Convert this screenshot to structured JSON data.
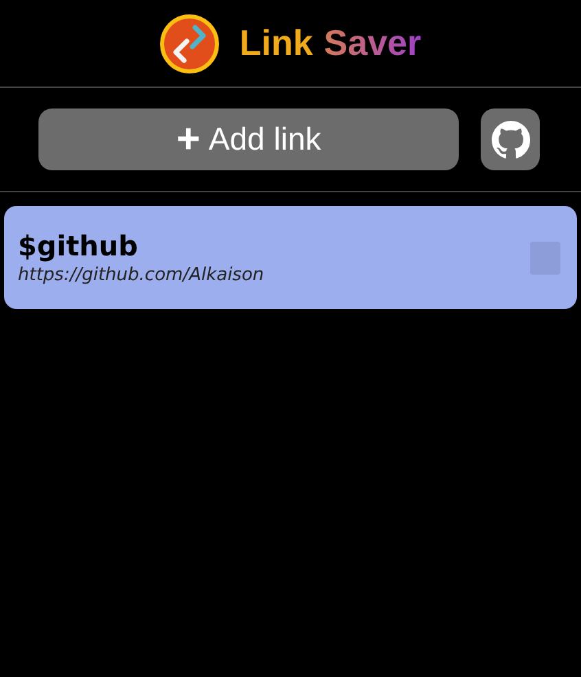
{
  "header": {
    "title_part_1": "Link",
    "title_part_2": "Saver"
  },
  "toolbar": {
    "add_button": {
      "icon": "+",
      "label": "Add link"
    }
  },
  "links": [
    {
      "name": "$github",
      "url": "https://github.com/Alkaison"
    }
  ]
}
